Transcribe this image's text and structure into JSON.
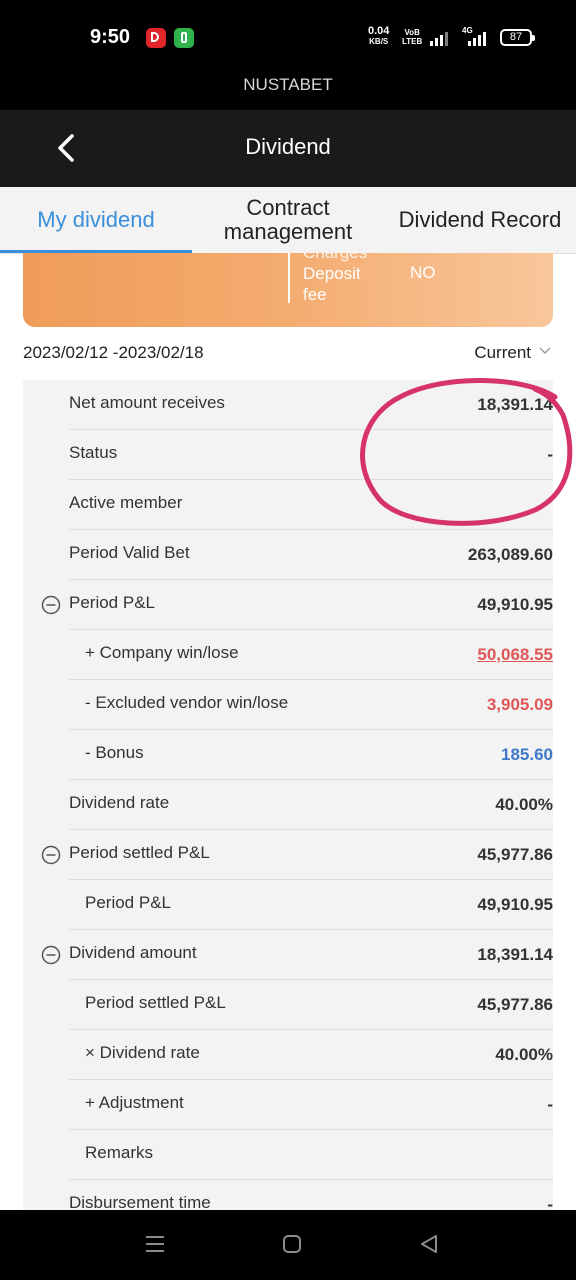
{
  "status_bar": {
    "time": "9:50",
    "speed_value": "0.04",
    "speed_unit": "KB/S",
    "volte_top": "VoB",
    "volte_bottom": "LTEB",
    "network": "4G",
    "battery": "87"
  },
  "app_name": "NUSTABET",
  "header": {
    "title": "Dividend"
  },
  "tabs": [
    {
      "label": "My dividend",
      "active": true
    },
    {
      "label": "Contract management",
      "active": false
    },
    {
      "label": "Dividend Record",
      "active": false
    }
  ],
  "banner": {
    "label_lines": [
      "Charges",
      "Deposit",
      "fee"
    ],
    "value": "NO"
  },
  "date_range": "2023/02/12 -2023/02/18",
  "period_selector": "Current",
  "rows": [
    {
      "label": "Net amount receives",
      "value": "18,391.14",
      "indent": false,
      "collapse_icon": false,
      "style": "normal"
    },
    {
      "label": "Status",
      "value": "-",
      "indent": false,
      "collapse_icon": false,
      "style": "normal"
    },
    {
      "label": "Active member",
      "value": "",
      "indent": false,
      "collapse_icon": false,
      "style": "normal"
    },
    {
      "label": "Period Valid Bet",
      "value": "263,089.60",
      "indent": false,
      "collapse_icon": false,
      "style": "normal"
    },
    {
      "label": "Period P&L",
      "value": "49,910.95",
      "indent": false,
      "collapse_icon": true,
      "style": "normal"
    },
    {
      "label": "+ Company win/lose",
      "value": "50,068.55",
      "indent": true,
      "collapse_icon": false,
      "style": "red-u"
    },
    {
      "label": "- Excluded vendor win/lose",
      "value": "3,905.09",
      "indent": true,
      "collapse_icon": false,
      "style": "red"
    },
    {
      "label": "- Bonus",
      "value": "185.60",
      "indent": true,
      "collapse_icon": false,
      "style": "blue"
    },
    {
      "label": "Dividend rate",
      "value": "40.00%",
      "indent": false,
      "collapse_icon": false,
      "style": "normal"
    },
    {
      "label": "Period settled P&L",
      "value": "45,977.86",
      "indent": false,
      "collapse_icon": true,
      "style": "normal"
    },
    {
      "label": "Period P&L",
      "value": "49,910.95",
      "indent": true,
      "collapse_icon": false,
      "style": "normal"
    },
    {
      "label": "Dividend amount",
      "value": "18,391.14",
      "indent": false,
      "collapse_icon": true,
      "style": "normal"
    },
    {
      "label": "Period settled P&L",
      "value": "45,977.86",
      "indent": true,
      "collapse_icon": false,
      "style": "normal"
    },
    {
      "label": "× Dividend rate",
      "value": "40.00%",
      "indent": true,
      "collapse_icon": false,
      "style": "normal"
    },
    {
      "label": "+ Adjustment",
      "value": "-",
      "indent": true,
      "collapse_icon": false,
      "style": "normal"
    },
    {
      "label": "Remarks",
      "value": "",
      "indent": true,
      "collapse_icon": false,
      "style": "normal"
    },
    {
      "label": "Disbursement time",
      "value": "-",
      "indent": false,
      "collapse_icon": false,
      "style": "normal"
    }
  ],
  "colors": {
    "tab_active": "#3a8fdb",
    "value_red": "#e05757",
    "value_blue": "#3f78c8",
    "annotation_circle": "#d6336c",
    "banner_start": "#ef9c58",
    "banner_end": "#f8c79b"
  }
}
